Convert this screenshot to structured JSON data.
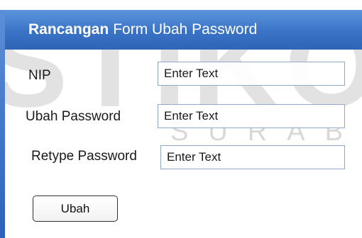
{
  "window": {
    "title_bold": "Rancangan",
    "title_rest": "Form Ubah Password"
  },
  "form": {
    "nip_label": "NIP",
    "nip_value": "Enter Text",
    "new_password_label": "Ubah Password",
    "new_password_value": "Enter Text",
    "retype_password_label": "Retype Password",
    "retype_password_value": "Enter Text",
    "submit_label": "Ubah"
  },
  "watermark": {
    "logo_text": "STIKOM",
    "sub_text": "SURABAYA"
  },
  "colors": {
    "title_bar": "#3a73c6",
    "field_border": "#8fa9c8",
    "watermark": "#dcdcdc"
  }
}
